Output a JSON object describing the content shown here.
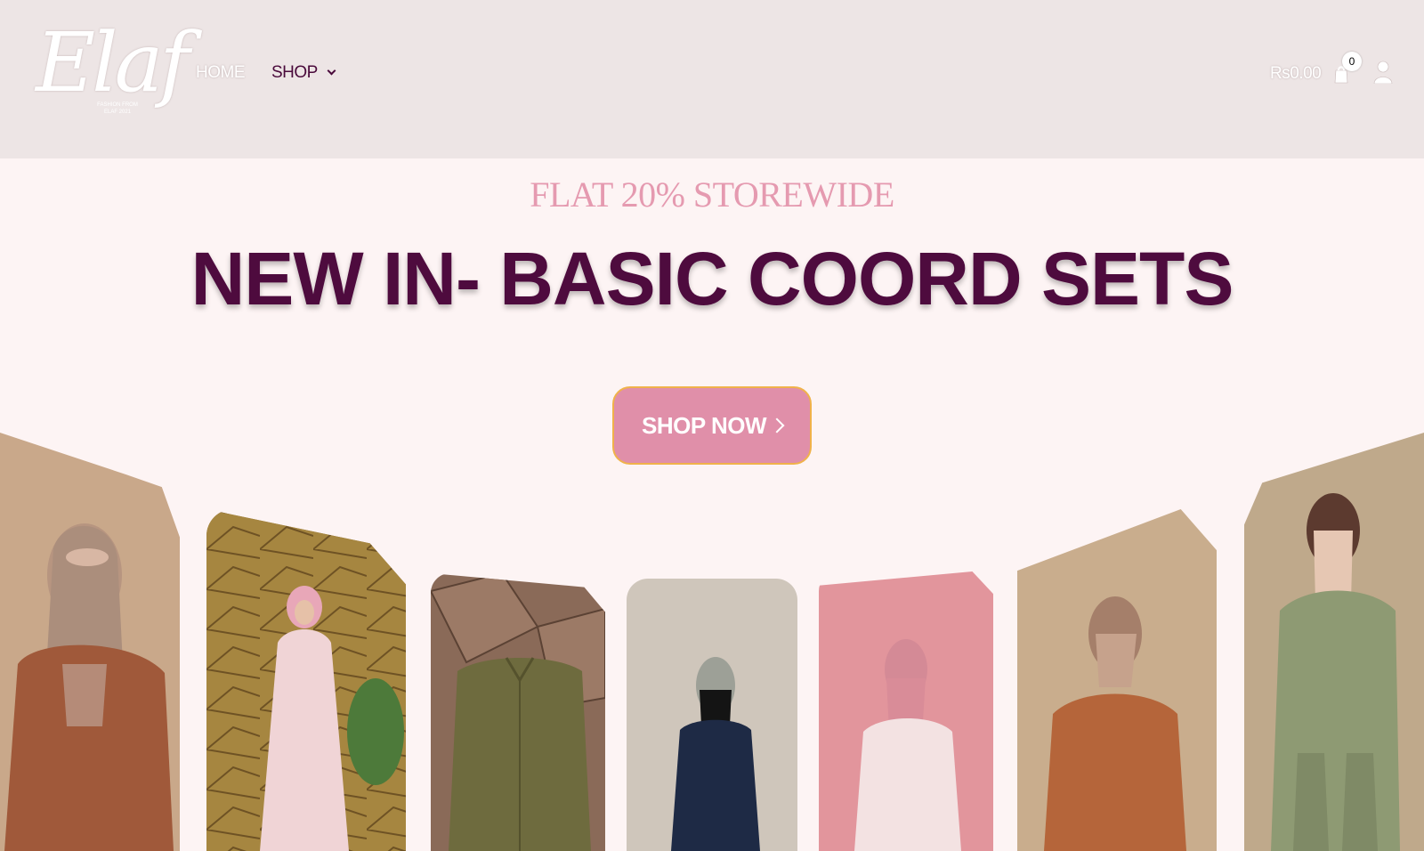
{
  "header": {
    "logo": {
      "name": "Elaf",
      "tagline": "FASHION FROM ELAF 2021"
    },
    "nav": {
      "home": "HOME",
      "shop": "SHOP"
    },
    "cart": {
      "total": "Rs0.00",
      "count": "0"
    }
  },
  "hero": {
    "promo": "FLAT 20% STOREWIDE",
    "headline": "NEW IN- BASIC COORD SETS",
    "cta": "SHOP NOW"
  },
  "colors": {
    "header_bg": "#ede5e5",
    "page_bg": "#fdf4f4",
    "brand_plum": "#4e0b3e",
    "accent_pink": "#e08fa9",
    "promo_pink": "#e59ab0"
  },
  "cards": [
    {
      "outfit": "rust coord set with beige hijab",
      "bg": "#c9a88a"
    },
    {
      "outfit": "light pink dress",
      "bg": "#9a7a3a"
    },
    {
      "outfit": "olive shirt flat lay",
      "bg": "#8a6a58"
    },
    {
      "outfit": "navy coord set",
      "bg": "#cfc6bb"
    },
    {
      "outfit": "pink blouse with pink hijab",
      "bg": "#e2959c"
    },
    {
      "outfit": "rust coord set with beige niqab",
      "bg": "#c9ad8d"
    },
    {
      "outfit": "sage green coord set",
      "bg": "#bfa98b"
    }
  ]
}
